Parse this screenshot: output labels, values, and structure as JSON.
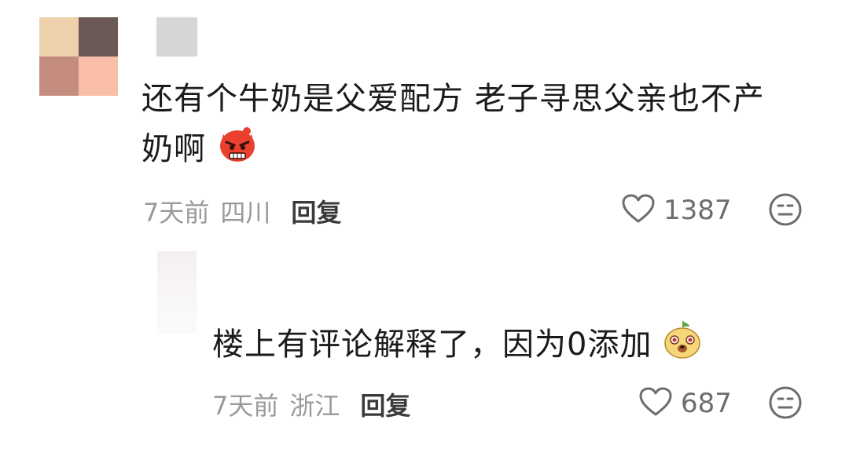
{
  "comment": {
    "text_line1": "还有个牛奶是父爱配方 老子寻思父亲也不产",
    "text_line2": "奶啊",
    "time": "7天前",
    "location": "四川",
    "reply_label": "回复",
    "likes": "1387",
    "emoji": "angry-face-icon",
    "avatar_colors": [
      "#ecd1ac",
      "#6b5957",
      "#c48c7f",
      "#f9bfa8"
    ]
  },
  "reply": {
    "text": "楼上有评论解释了，因为0添加",
    "time": "7天前",
    "location": "浙江",
    "reply_label": "回复",
    "likes": "687",
    "emoji": "puppy-face-icon"
  },
  "colors": {
    "meta": "#9a9a9a",
    "text": "#1b1b1b",
    "icon": "#6d6d6d"
  }
}
